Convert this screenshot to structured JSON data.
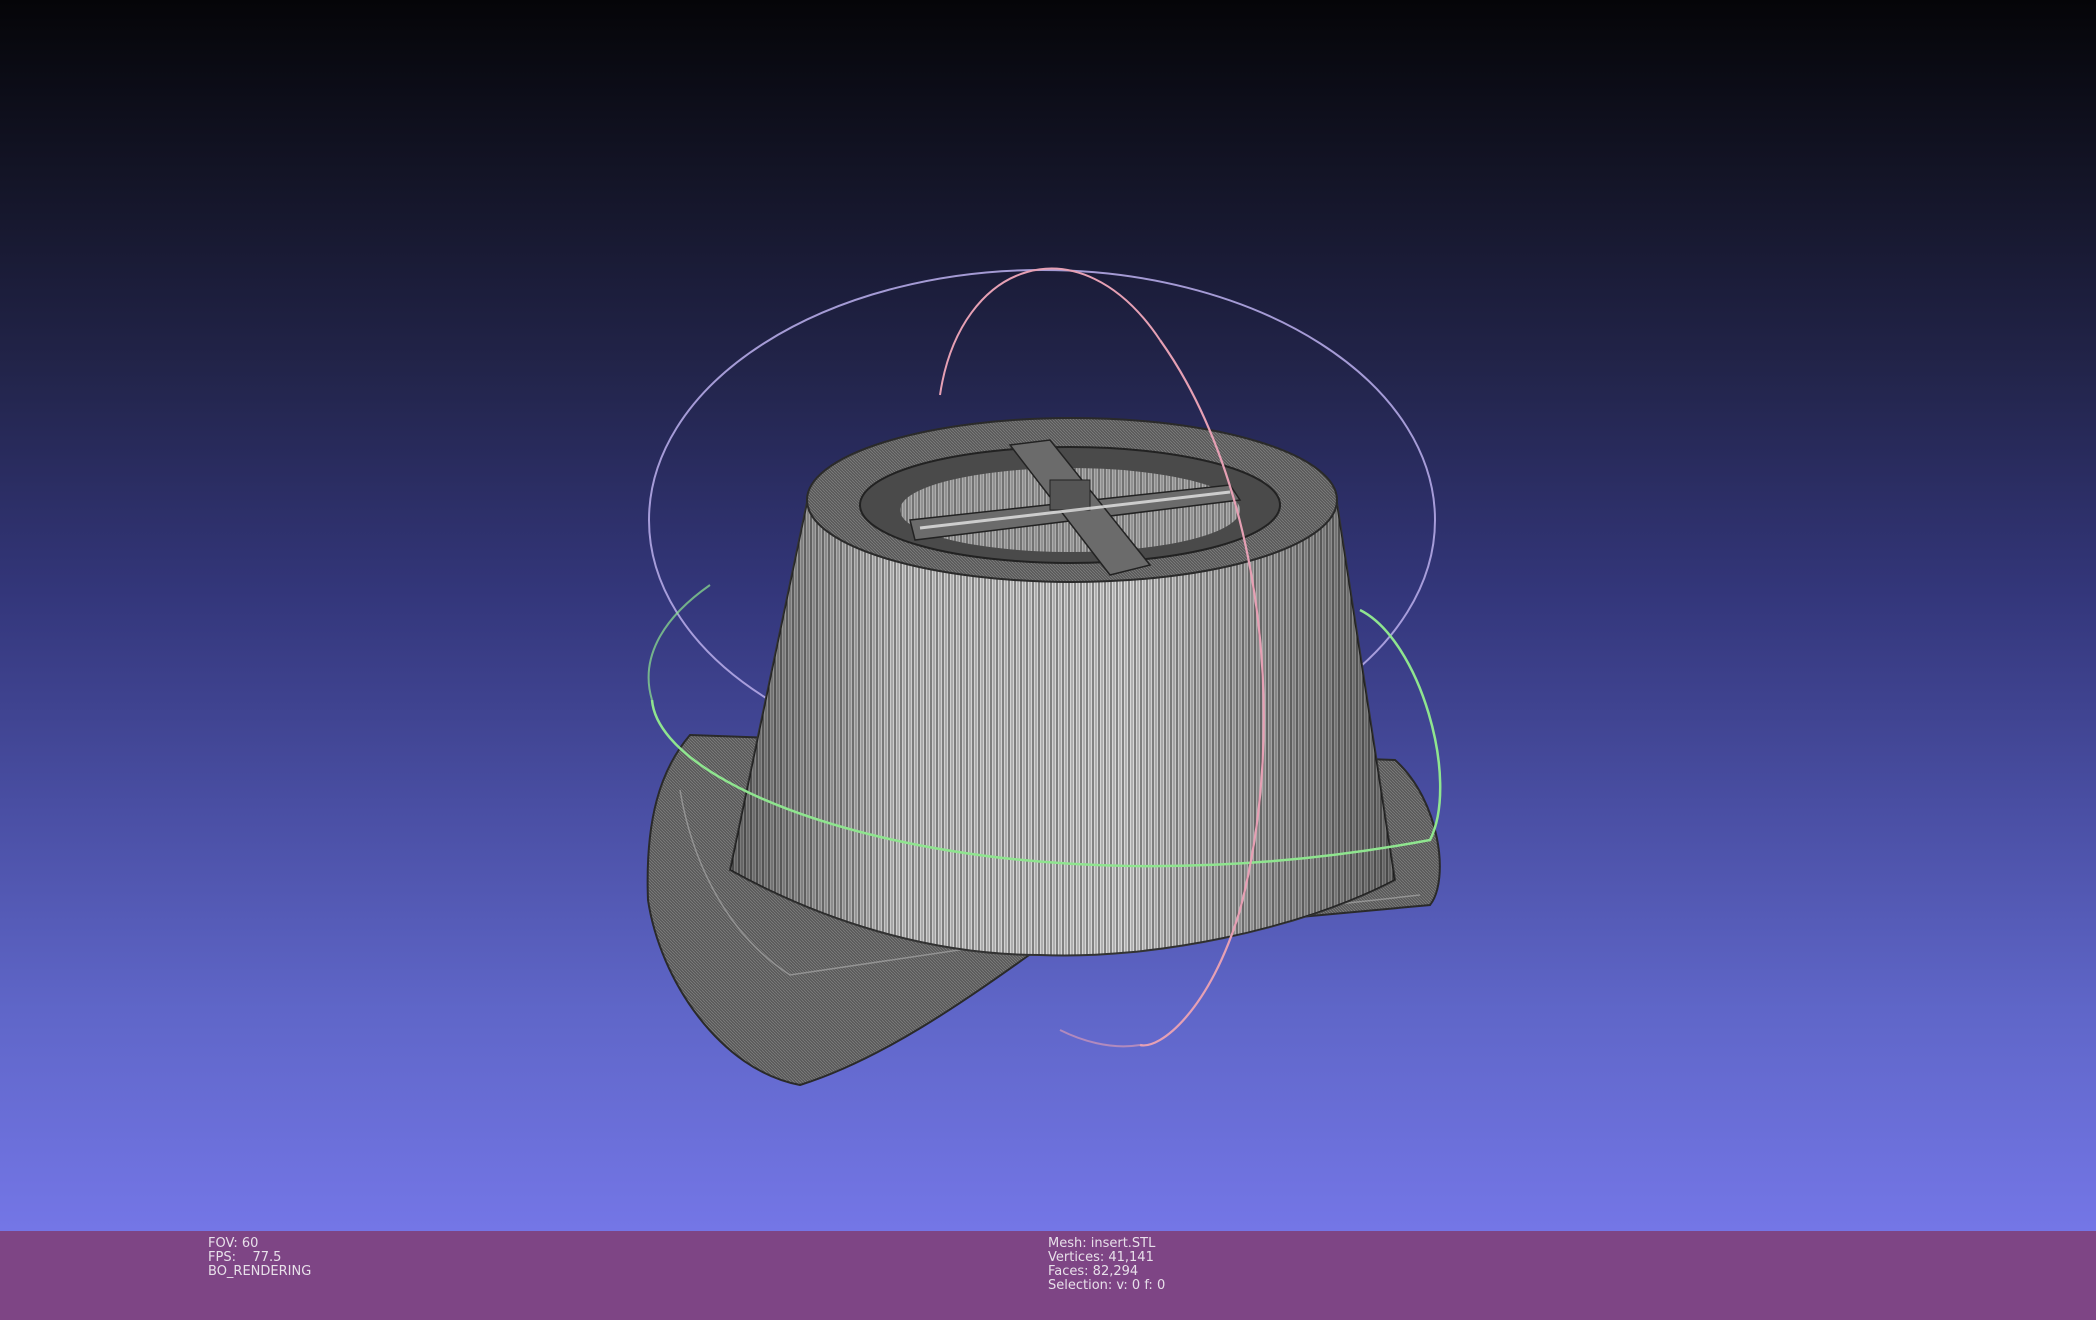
{
  "viewport": {
    "object_description": "wireframe-mesh-insert",
    "trackball": {
      "colors": {
        "horizontal": "#8fe58f",
        "vertical": "#e6a0b4",
        "tilted": "#b4a8e6"
      }
    },
    "background_colors": {
      "top": "#050508",
      "bottom": "#7476e6"
    }
  },
  "status": {
    "fov": "FOV: 60",
    "fps": "FPS:    77.5",
    "mode": "BO_RENDERING",
    "mesh": "Mesh: insert.STL",
    "vertices": "Vertices: 41,141",
    "faces": "Faces: 82,294",
    "selection": "Selection: v: 0 f: 0"
  },
  "colors": {
    "status_bar": "#7e4585",
    "mesh_fill": "#d9d9d9",
    "mesh_edge": "#3a3a3a"
  }
}
